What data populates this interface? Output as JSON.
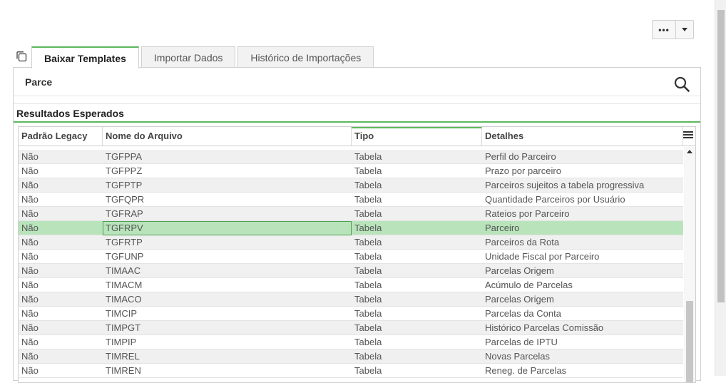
{
  "toolbar": {
    "more_label": "•••"
  },
  "tabs": [
    {
      "label": "Baixar Templates",
      "active": true
    },
    {
      "label": "Importar Dados",
      "active": false
    },
    {
      "label": "Histórico de Importações",
      "active": false
    }
  ],
  "search": {
    "value": "Parce"
  },
  "results": {
    "title": "Resultados Esperados",
    "columns": [
      "Padrão Legacy",
      "Nome do Arquivo",
      "Tipo",
      "Detalhes"
    ],
    "sorted_column": "Tipo",
    "rows": [
      {
        "legacy": "Não",
        "file": "TGFPPA",
        "type": "Tabela",
        "details": "Perfil do Parceiro"
      },
      {
        "legacy": "Não",
        "file": "TGFPPZ",
        "type": "Tabela",
        "details": "Prazo por parceiro"
      },
      {
        "legacy": "Não",
        "file": "TGFPTP",
        "type": "Tabela",
        "details": "Parceiros sujeitos a tabela progressiva"
      },
      {
        "legacy": "Não",
        "file": "TGFQPR",
        "type": "Tabela",
        "details": "Quantidade Parceiros por Usuário"
      },
      {
        "legacy": "Não",
        "file": "TGFRAP",
        "type": "Tabela",
        "details": "Rateios por Parceiro"
      },
      {
        "legacy": "Não",
        "file": "TGFRPV",
        "type": "Tabela",
        "details": "Parceiro",
        "selected": true
      },
      {
        "legacy": "Não",
        "file": "TGFRTP",
        "type": "Tabela",
        "details": "Parceiros da Rota"
      },
      {
        "legacy": "Não",
        "file": "TGFUNP",
        "type": "Tabela",
        "details": "Unidade Fiscal por Parceiro"
      },
      {
        "legacy": "Não",
        "file": "TIMAAC",
        "type": "Tabela",
        "details": "Parcelas Origem"
      },
      {
        "legacy": "Não",
        "file": "TIMACM",
        "type": "Tabela",
        "details": "Acúmulo de Parcelas"
      },
      {
        "legacy": "Não",
        "file": "TIMACO",
        "type": "Tabela",
        "details": "Parcelas Origem"
      },
      {
        "legacy": "Não",
        "file": "TIMCIP",
        "type": "Tabela",
        "details": "Parcelas da Conta"
      },
      {
        "legacy": "Não",
        "file": "TIMPGT",
        "type": "Tabela",
        "details": "Histórico Parcelas Comissão"
      },
      {
        "legacy": "Não",
        "file": "TIMPIP",
        "type": "Tabela",
        "details": "Parcelas de IPTU"
      },
      {
        "legacy": "Não",
        "file": "TIMREL",
        "type": "Tabela",
        "details": "Novas Parcelas"
      },
      {
        "legacy": "Não",
        "file": "TIMREN",
        "type": "Tabela",
        "details": "Reneg. de Parcelas"
      }
    ]
  },
  "colors": {
    "accent": "#5cb85c",
    "selected_row": "#b9e4bb"
  }
}
